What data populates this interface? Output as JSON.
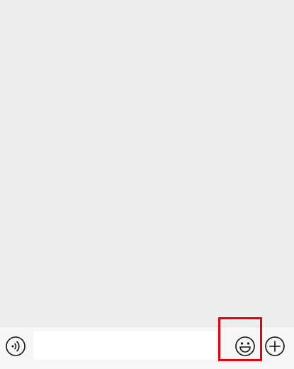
{
  "chat": {
    "messages": []
  },
  "input_bar": {
    "voice_button": {
      "icon": "voice-icon"
    },
    "message_input": {
      "value": "",
      "placeholder": ""
    },
    "emoji_button": {
      "icon": "emoji-icon"
    },
    "more_button": {
      "icon": "plus-circle-icon"
    }
  },
  "annotation": {
    "highlight_color": "#e8000b",
    "highlighted_element": "emoji-button"
  },
  "colors": {
    "chat_background": "#ededed",
    "input_bar_background": "#f6f6f6",
    "input_field_background": "#ffffff",
    "icon_color": "#111111"
  }
}
